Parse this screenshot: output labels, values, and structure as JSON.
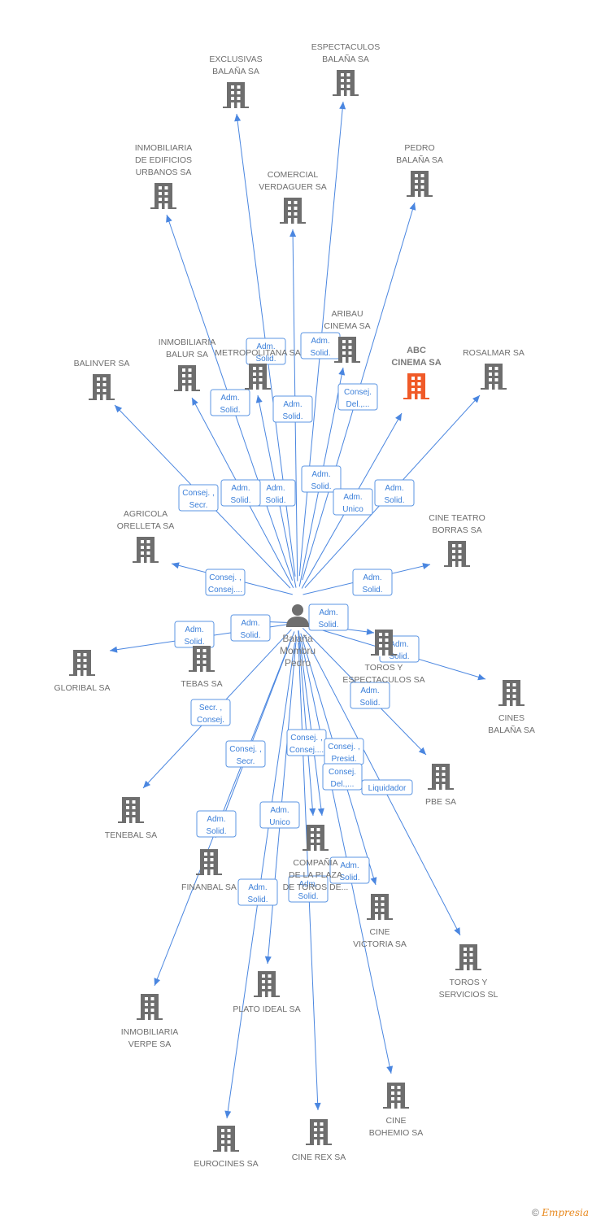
{
  "colors": {
    "edge": "#4a86e0",
    "node": "#6e6e6e",
    "highlight": "#f05a28"
  },
  "person": {
    "name_lines": [
      "Balaña",
      "Mombru",
      "Pedro"
    ],
    "icon": "person-icon"
  },
  "nodes": [
    {
      "lines": [
        "EXCLUSIVAS",
        "BALAÑA SA"
      ]
    },
    {
      "lines": [
        "ESPECTACULOS",
        "BALAÑA SA"
      ]
    },
    {
      "lines": [
        "INMOBILIARIA",
        "DE EDIFICIOS",
        "URBANOS SA"
      ]
    },
    {
      "lines": [
        "COMERCIAL",
        "VERDAGUER SA"
      ]
    },
    {
      "lines": [
        "PEDRO",
        "BALAÑA SA"
      ]
    },
    {
      "lines": [
        "ARIBAU",
        "CINEMA SA"
      ]
    },
    {
      "lines": [
        "ABC",
        "CINEMA SA"
      ],
      "highlight": true
    },
    {
      "lines": [
        "ROSALMAR SA"
      ]
    },
    {
      "lines": [
        "METROPOLITANA SA"
      ]
    },
    {
      "lines": [
        "INMOBILIARIA",
        "BALUR SA"
      ]
    },
    {
      "lines": [
        "BALINVER SA"
      ]
    },
    {
      "lines": [
        "AGRICOLA",
        "ORELLETA SA"
      ]
    },
    {
      "lines": [
        "CINE TEATRO",
        "BORRAS SA"
      ]
    },
    {
      "lines": [
        "GLORIBAL SA"
      ]
    },
    {
      "lines": [
        "TEBAS SA"
      ]
    },
    {
      "lines": [
        "TOROS Y",
        "ESPECTACULOS SA"
      ]
    },
    {
      "lines": [
        "CINES",
        "BALAÑA SA"
      ]
    },
    {
      "lines": [
        "PBE SA"
      ]
    },
    {
      "lines": [
        "TENEBAL SA"
      ]
    },
    {
      "lines": [
        "FINANBAL SA"
      ]
    },
    {
      "lines": [
        "INMOBILIARIA",
        "VERPE SA"
      ]
    },
    {
      "lines": [
        "COMPAÑIA",
        "DE LA PLAZA",
        "DE TOROS DE..."
      ]
    },
    {
      "lines": [
        "CINE",
        "VICTORIA SA"
      ]
    },
    {
      "lines": [
        "PLATO IDEAL SA"
      ]
    },
    {
      "lines": [
        "EUROCINES SA"
      ]
    },
    {
      "lines": [
        "CINE REX SA"
      ]
    },
    {
      "lines": [
        "CINE",
        "BOHEMIO SA"
      ]
    },
    {
      "lines": [
        "TOROS Y",
        "SERVICIOS SL"
      ]
    }
  ],
  "edges": [
    {
      "to": 0,
      "label": [
        "Adm.",
        "Solid."
      ]
    },
    {
      "to": 1,
      "label": [
        "Adm.",
        "Solid."
      ]
    },
    {
      "to": 2,
      "label": [
        "Adm.",
        "Solid."
      ]
    },
    {
      "to": 3,
      "label": [
        "Adm.",
        "Solid."
      ]
    },
    {
      "to": 4,
      "label": [
        "Consej.",
        "Del.,..."
      ]
    },
    {
      "to": 5,
      "label": [
        "Adm.",
        "Solid."
      ]
    },
    {
      "to": 6,
      "label": [
        "Adm.",
        "Unico"
      ]
    },
    {
      "to": 7,
      "label": [
        "Adm.",
        "Solid."
      ]
    },
    {
      "to": 8,
      "label": [
        "Adm.",
        "Solid."
      ]
    },
    {
      "to": 9,
      "label": [
        "Adm.",
        "Solid."
      ]
    },
    {
      "to": 10,
      "label": [
        "Consej. ,",
        "Secr."
      ]
    },
    {
      "to": 11,
      "label": [
        "Consej. ,",
        "Consej...."
      ]
    },
    {
      "to": 12,
      "label": [
        "Adm.",
        "Solid."
      ]
    },
    {
      "to": 13,
      "label": [
        "Adm.",
        "Solid."
      ]
    },
    {
      "to": 14,
      "label": [
        "Adm.",
        "Solid."
      ]
    },
    {
      "to": 15,
      "label": [
        "Adm.",
        "Solid."
      ]
    },
    {
      "to": 16,
      "label": [
        "Adm.",
        "Solid."
      ]
    },
    {
      "to": 17,
      "label": [
        "Adm.",
        "Solid."
      ]
    },
    {
      "to": 18,
      "label": [
        "Secr. ,",
        "Consej."
      ]
    },
    {
      "to": 19,
      "label": [
        "Consej. ,",
        "Secr."
      ]
    },
    {
      "to": 20,
      "label": [
        "Adm.",
        "Solid."
      ]
    },
    {
      "to": 21,
      "label": [
        "Consej. ,",
        "Consej...."
      ]
    },
    {
      "to": 21,
      "label": [
        "Consej. ,",
        "Presid."
      ]
    },
    {
      "to": 22,
      "label": [
        "Consej.",
        "Del.,..."
      ]
    },
    {
      "to": 23,
      "label": [
        "Adm.",
        "Unico"
      ]
    },
    {
      "to": 24,
      "label": [
        "Adm.",
        "Solid."
      ]
    },
    {
      "to": 25,
      "label": [
        "Adm.",
        "Solid."
      ]
    },
    {
      "to": 26,
      "label": [
        "Adm.",
        "Solid."
      ]
    },
    {
      "to": 27,
      "label": [
        "Liquidador"
      ]
    }
  ],
  "footer": {
    "copyright": "©",
    "brand": "Empresia"
  }
}
